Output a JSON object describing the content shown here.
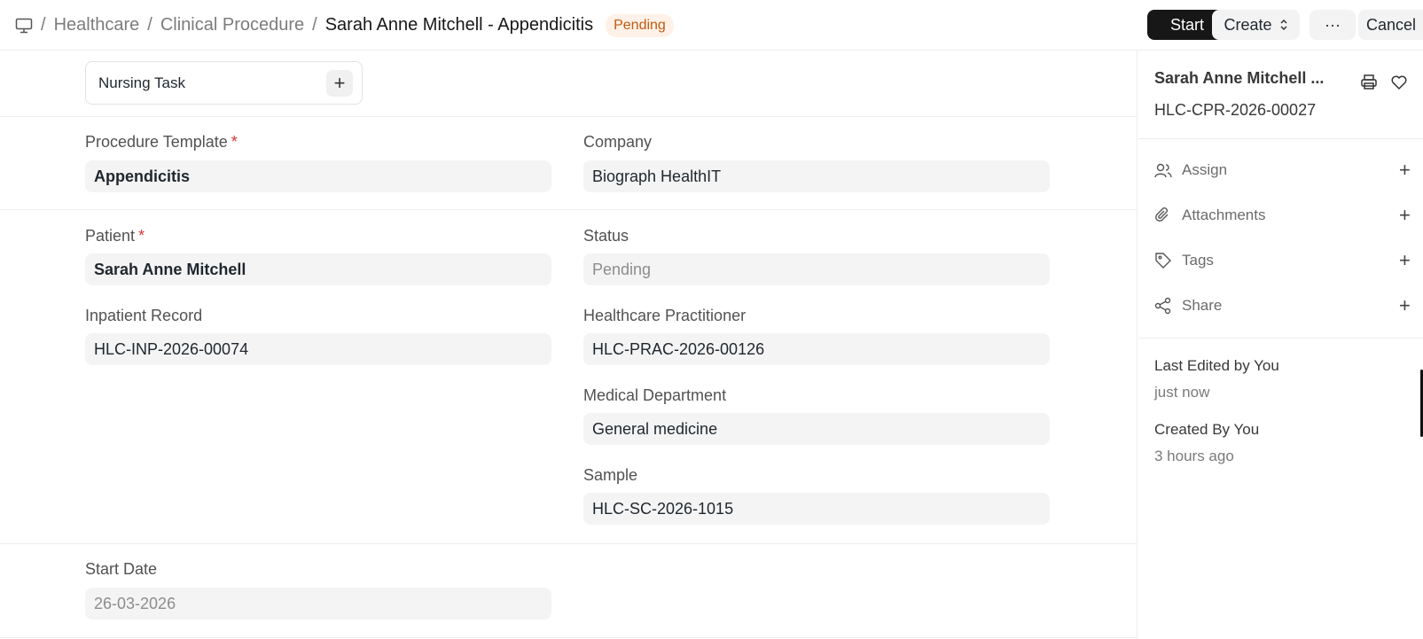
{
  "breadcrumb": {
    "items": [
      "Healthcare",
      "Clinical Procedure"
    ],
    "current": "Sarah Anne Mitchell - Appendicitis",
    "separator": "/"
  },
  "status_badge": "Pending",
  "toolbar": {
    "start": "Start",
    "create": "Create",
    "more": "···",
    "cancel": "Cancel"
  },
  "nursing_task": {
    "label": "Nursing Task",
    "add": "+"
  },
  "fields": {
    "procedure_template": {
      "label": "Procedure Template",
      "required": "*",
      "value": "Appendicitis"
    },
    "company": {
      "label": "Company",
      "value": "Biograph HealthIT"
    },
    "patient": {
      "label": "Patient",
      "required": "*",
      "value": "Sarah Anne Mitchell"
    },
    "status": {
      "label": "Status",
      "value": "Pending"
    },
    "inpatient_record": {
      "label": "Inpatient Record",
      "value": "HLC-INP-2026-00074"
    },
    "healthcare_practitioner": {
      "label": "Healthcare Practitioner",
      "value": "HLC-PRAC-2026-00126"
    },
    "medical_department": {
      "label": "Medical Department",
      "value": "General medicine"
    },
    "sample": {
      "label": "Sample",
      "value": "HLC-SC-2026-1015"
    },
    "start_date": {
      "label": "Start Date",
      "value": "26-03-2026"
    }
  },
  "sidebar": {
    "title": "Sarah Anne Mitchell ...",
    "doc_id": "HLC-CPR-2026-00027",
    "actions": [
      {
        "label": "Assign",
        "icon": "users-icon"
      },
      {
        "label": "Attachments",
        "icon": "paperclip-icon"
      },
      {
        "label": "Tags",
        "icon": "tag-icon"
      },
      {
        "label": "Share",
        "icon": "share-icon"
      }
    ],
    "plus": "+",
    "last_edited": "Last Edited by You",
    "last_edited_time": "just now",
    "created": "Created By You",
    "created_time": "3 hours ago"
  },
  "colors": {
    "accent_dark": "#171717",
    "badge_bg": "#fff1e7",
    "badge_text": "#c15a12",
    "required": "#e03636"
  }
}
